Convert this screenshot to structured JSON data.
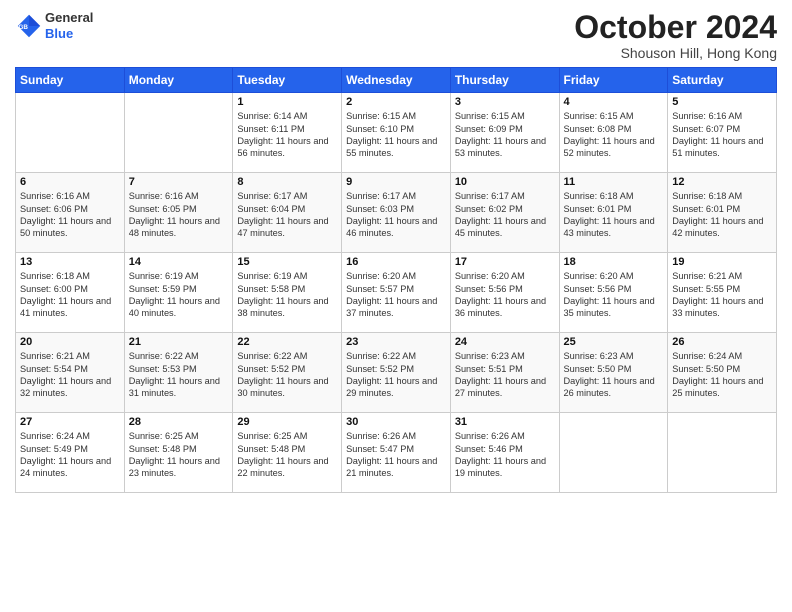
{
  "logo": {
    "line1": "General",
    "line2": "Blue"
  },
  "header": {
    "month": "October 2024",
    "location": "Shouson Hill, Hong Kong"
  },
  "weekdays": [
    "Sunday",
    "Monday",
    "Tuesday",
    "Wednesday",
    "Thursday",
    "Friday",
    "Saturday"
  ],
  "weeks": [
    [
      {
        "day": "",
        "info": ""
      },
      {
        "day": "",
        "info": ""
      },
      {
        "day": "1",
        "info": "Sunrise: 6:14 AM\nSunset: 6:11 PM\nDaylight: 11 hours and 56 minutes."
      },
      {
        "day": "2",
        "info": "Sunrise: 6:15 AM\nSunset: 6:10 PM\nDaylight: 11 hours and 55 minutes."
      },
      {
        "day": "3",
        "info": "Sunrise: 6:15 AM\nSunset: 6:09 PM\nDaylight: 11 hours and 53 minutes."
      },
      {
        "day": "4",
        "info": "Sunrise: 6:15 AM\nSunset: 6:08 PM\nDaylight: 11 hours and 52 minutes."
      },
      {
        "day": "5",
        "info": "Sunrise: 6:16 AM\nSunset: 6:07 PM\nDaylight: 11 hours and 51 minutes."
      }
    ],
    [
      {
        "day": "6",
        "info": "Sunrise: 6:16 AM\nSunset: 6:06 PM\nDaylight: 11 hours and 50 minutes."
      },
      {
        "day": "7",
        "info": "Sunrise: 6:16 AM\nSunset: 6:05 PM\nDaylight: 11 hours and 48 minutes."
      },
      {
        "day": "8",
        "info": "Sunrise: 6:17 AM\nSunset: 6:04 PM\nDaylight: 11 hours and 47 minutes."
      },
      {
        "day": "9",
        "info": "Sunrise: 6:17 AM\nSunset: 6:03 PM\nDaylight: 11 hours and 46 minutes."
      },
      {
        "day": "10",
        "info": "Sunrise: 6:17 AM\nSunset: 6:02 PM\nDaylight: 11 hours and 45 minutes."
      },
      {
        "day": "11",
        "info": "Sunrise: 6:18 AM\nSunset: 6:01 PM\nDaylight: 11 hours and 43 minutes."
      },
      {
        "day": "12",
        "info": "Sunrise: 6:18 AM\nSunset: 6:01 PM\nDaylight: 11 hours and 42 minutes."
      }
    ],
    [
      {
        "day": "13",
        "info": "Sunrise: 6:18 AM\nSunset: 6:00 PM\nDaylight: 11 hours and 41 minutes."
      },
      {
        "day": "14",
        "info": "Sunrise: 6:19 AM\nSunset: 5:59 PM\nDaylight: 11 hours and 40 minutes."
      },
      {
        "day": "15",
        "info": "Sunrise: 6:19 AM\nSunset: 5:58 PM\nDaylight: 11 hours and 38 minutes."
      },
      {
        "day": "16",
        "info": "Sunrise: 6:20 AM\nSunset: 5:57 PM\nDaylight: 11 hours and 37 minutes."
      },
      {
        "day": "17",
        "info": "Sunrise: 6:20 AM\nSunset: 5:56 PM\nDaylight: 11 hours and 36 minutes."
      },
      {
        "day": "18",
        "info": "Sunrise: 6:20 AM\nSunset: 5:56 PM\nDaylight: 11 hours and 35 minutes."
      },
      {
        "day": "19",
        "info": "Sunrise: 6:21 AM\nSunset: 5:55 PM\nDaylight: 11 hours and 33 minutes."
      }
    ],
    [
      {
        "day": "20",
        "info": "Sunrise: 6:21 AM\nSunset: 5:54 PM\nDaylight: 11 hours and 32 minutes."
      },
      {
        "day": "21",
        "info": "Sunrise: 6:22 AM\nSunset: 5:53 PM\nDaylight: 11 hours and 31 minutes."
      },
      {
        "day": "22",
        "info": "Sunrise: 6:22 AM\nSunset: 5:52 PM\nDaylight: 11 hours and 30 minutes."
      },
      {
        "day": "23",
        "info": "Sunrise: 6:22 AM\nSunset: 5:52 PM\nDaylight: 11 hours and 29 minutes."
      },
      {
        "day": "24",
        "info": "Sunrise: 6:23 AM\nSunset: 5:51 PM\nDaylight: 11 hours and 27 minutes."
      },
      {
        "day": "25",
        "info": "Sunrise: 6:23 AM\nSunset: 5:50 PM\nDaylight: 11 hours and 26 minutes."
      },
      {
        "day": "26",
        "info": "Sunrise: 6:24 AM\nSunset: 5:50 PM\nDaylight: 11 hours and 25 minutes."
      }
    ],
    [
      {
        "day": "27",
        "info": "Sunrise: 6:24 AM\nSunset: 5:49 PM\nDaylight: 11 hours and 24 minutes."
      },
      {
        "day": "28",
        "info": "Sunrise: 6:25 AM\nSunset: 5:48 PM\nDaylight: 11 hours and 23 minutes."
      },
      {
        "day": "29",
        "info": "Sunrise: 6:25 AM\nSunset: 5:48 PM\nDaylight: 11 hours and 22 minutes."
      },
      {
        "day": "30",
        "info": "Sunrise: 6:26 AM\nSunset: 5:47 PM\nDaylight: 11 hours and 21 minutes."
      },
      {
        "day": "31",
        "info": "Sunrise: 6:26 AM\nSunset: 5:46 PM\nDaylight: 11 hours and 19 minutes."
      },
      {
        "day": "",
        "info": ""
      },
      {
        "day": "",
        "info": ""
      }
    ]
  ]
}
